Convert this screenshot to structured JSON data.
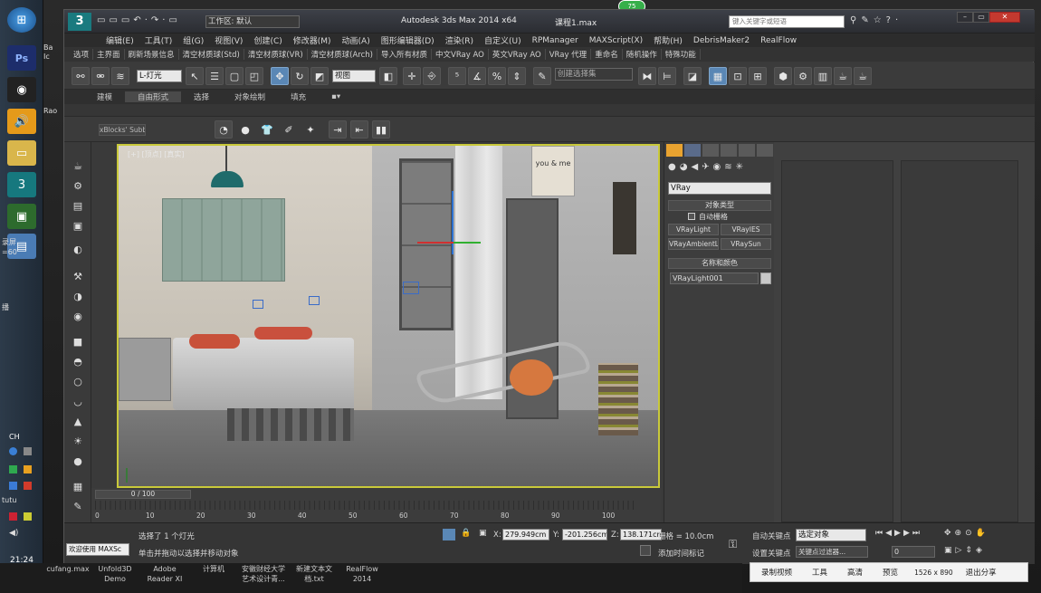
{
  "taskbar": {
    "labels": [
      "Ba",
      "Ic",
      "Rao",
      "翻",
      "tut",
      "CH"
    ],
    "side_texts": [
      "录屏",
      "=60",
      "播",
      "tutu"
    ],
    "time": "21:24"
  },
  "window": {
    "app_title": "Autodesk 3ds Max  2014 x64",
    "file_title": "课程1.max",
    "workspace_label": "工作区: 默认",
    "search_placeholder": "键入关键字或短语"
  },
  "menu": {
    "items": [
      "编辑(E)",
      "工具(T)",
      "组(G)",
      "视图(V)",
      "创建(C)",
      "修改器(M)",
      "动画(A)",
      "图形编辑器(D)",
      "渲染(R)",
      "自定义(U)",
      "RPManager",
      "MAXScript(X)",
      "帮助(H)",
      "DebrisMaker2",
      "RealFlow"
    ]
  },
  "plugins": {
    "items": [
      "选项",
      "主界面",
      "刷新场景信息",
      "清空材质球(Std)",
      "清空材质球(VR)",
      "清空材质球(Arch)",
      "导入所有材质",
      "中文VRay AO",
      "英文VRay AO",
      "VRay 代理",
      "重命名",
      "随机操作",
      "特殊功能"
    ]
  },
  "toolbar": {
    "selection_filter": "L-灯光",
    "reference_coord": "视图",
    "named_selection": "创建选择集",
    "snap_angle": "2.5"
  },
  "ribbon": {
    "tabs": [
      "建模",
      "自由形式",
      "选择",
      "对象绘制",
      "填充"
    ],
    "sub_label": "xBlocks' Subb"
  },
  "viewport": {
    "label": "[+] [顶点] [真实]",
    "wall_text": "you & me"
  },
  "command_panel": {
    "category": "VRay",
    "rollout_object_type": "对象类型",
    "auto_grid": "自动栅格",
    "buttons": [
      "VRayLight",
      "VRayIES",
      "VRayAmbientLight",
      "VRaySun"
    ],
    "rollout_name_color": "名称和颜色",
    "object_name": "VRayLight001",
    "swatch_color": "#c8c8c8"
  },
  "timeline": {
    "frame_display": "0 / 100",
    "ticks": [
      "0",
      "10",
      "20",
      "30",
      "40",
      "50",
      "60",
      "70",
      "80",
      "90",
      "100"
    ]
  },
  "status": {
    "welcome": "欢迎使用 MAXSc",
    "selected_info": "选择了 1 个灯光",
    "prompt": "单击并拖动以选择并移动对象",
    "x_label": "X:",
    "x_value": "279.949cm",
    "y_label": "Y:",
    "y_value": "-201.256cm",
    "z_label": "Z:",
    "z_value": "138.171cm",
    "grid": "栅格 = 10.0cm",
    "add_time_tag": "添加时间标记",
    "auto_key": "自动关键点",
    "set_key": "设置关键点",
    "key_mode": "选定对象",
    "key_filters": "关键点过滤器...",
    "frame_field": "0"
  },
  "bottom_taskbar": {
    "items": [
      {
        "line1": "cufang.max",
        "line2": ""
      },
      {
        "line1": "Unfold3D",
        "line2": "Demo"
      },
      {
        "line1": "Adobe",
        "line2": "Reader XI"
      },
      {
        "line1": "计算机",
        "line2": ""
      },
      {
        "line1": "安徽财经大学",
        "line2": "艺术设计青..."
      },
      {
        "line1": "新建文本文",
        "line2": "档.txt"
      },
      {
        "line1": "RealFlow",
        "line2": "2014"
      }
    ]
  },
  "video_controls": {
    "items": [
      "录制视频",
      "工具",
      "高清",
      "预览",
      "1526 x 890",
      "退出分享"
    ]
  },
  "colors": {
    "accent_green": "#36b04a",
    "viewport_border": "#c9c93a",
    "active_button": "#5a87b5"
  }
}
